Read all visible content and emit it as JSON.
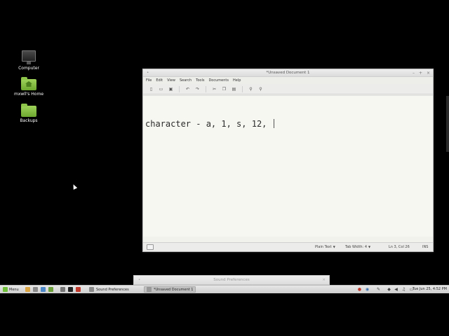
{
  "desktop": {
    "icons": [
      {
        "label": "Computer",
        "icon": "computer-icon"
      },
      {
        "label": "mxwll's Home",
        "icon": "home-folder-icon"
      },
      {
        "label": "Backups",
        "icon": "folder-icon"
      }
    ]
  },
  "editor": {
    "title": "*Unsaved Document 1",
    "menu": [
      "File",
      "Edit",
      "View",
      "Search",
      "Tools",
      "Documents",
      "Help"
    ],
    "text": "character - a, 1, s, 12, ",
    "status": {
      "language": "Plain Text",
      "tab_width": "Tab Width:  4",
      "position": "Ln 3, Col 26",
      "mode": "INS"
    }
  },
  "sound_window": {
    "title": "Sound Preferences"
  },
  "taskbar": {
    "menu_label": "Menu",
    "tasks": [
      {
        "label": "Sound Preferences",
        "active": false
      },
      {
        "label": "*Unsaved Document 1",
        "active": true
      }
    ],
    "clock": "Tue Jun 25,  4:52 PM"
  },
  "colors": {
    "desktop": "#000000",
    "editor_bg": "#f7f7f2",
    "accent_green": "#6fbf3a"
  }
}
